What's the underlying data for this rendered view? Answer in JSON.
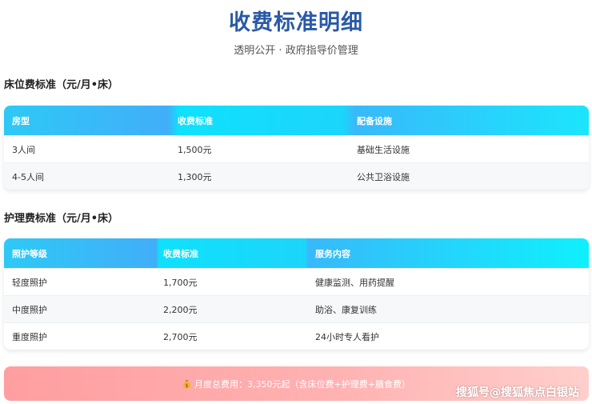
{
  "header": {
    "title": "收费标准明细",
    "subtitle": "透明公开 · 政府指导价管理"
  },
  "bed_fee": {
    "section_title": "床位费标准（元/月•床）",
    "columns": [
      "房型",
      "收费标准",
      "配备设施"
    ],
    "rows": [
      [
        "3人间",
        "1,500元",
        "基础生活设施"
      ],
      [
        "4-5人间",
        "1,300元",
        "公共卫浴设施"
      ]
    ]
  },
  "care_fee": {
    "section_title": "护理费标准（元/月•床）",
    "columns": [
      "照护等级",
      "收费标准",
      "服务内容"
    ],
    "rows": [
      [
        "轻度照护",
        "1,700元",
        "健康监测、用药提醒"
      ],
      [
        "中度照护",
        "2,200元",
        "助浴、康复训练"
      ],
      [
        "重度照护",
        "2,700元",
        "24小时专人看护"
      ]
    ]
  },
  "total": {
    "icon": "money-bag-icon",
    "text": "月度总费用：3,350元起（含床位费+护理费+膳食费）"
  },
  "watermark": "搜狐号@搜狐焦点白银站",
  "colors": {
    "title": "#2a5aa6",
    "header_gradient_start": "#2ec9f6",
    "header_gradient_end": "#1ce5fd",
    "total_gradient_start": "#ff9ea1",
    "total_gradient_end": "#ffcfcb"
  }
}
